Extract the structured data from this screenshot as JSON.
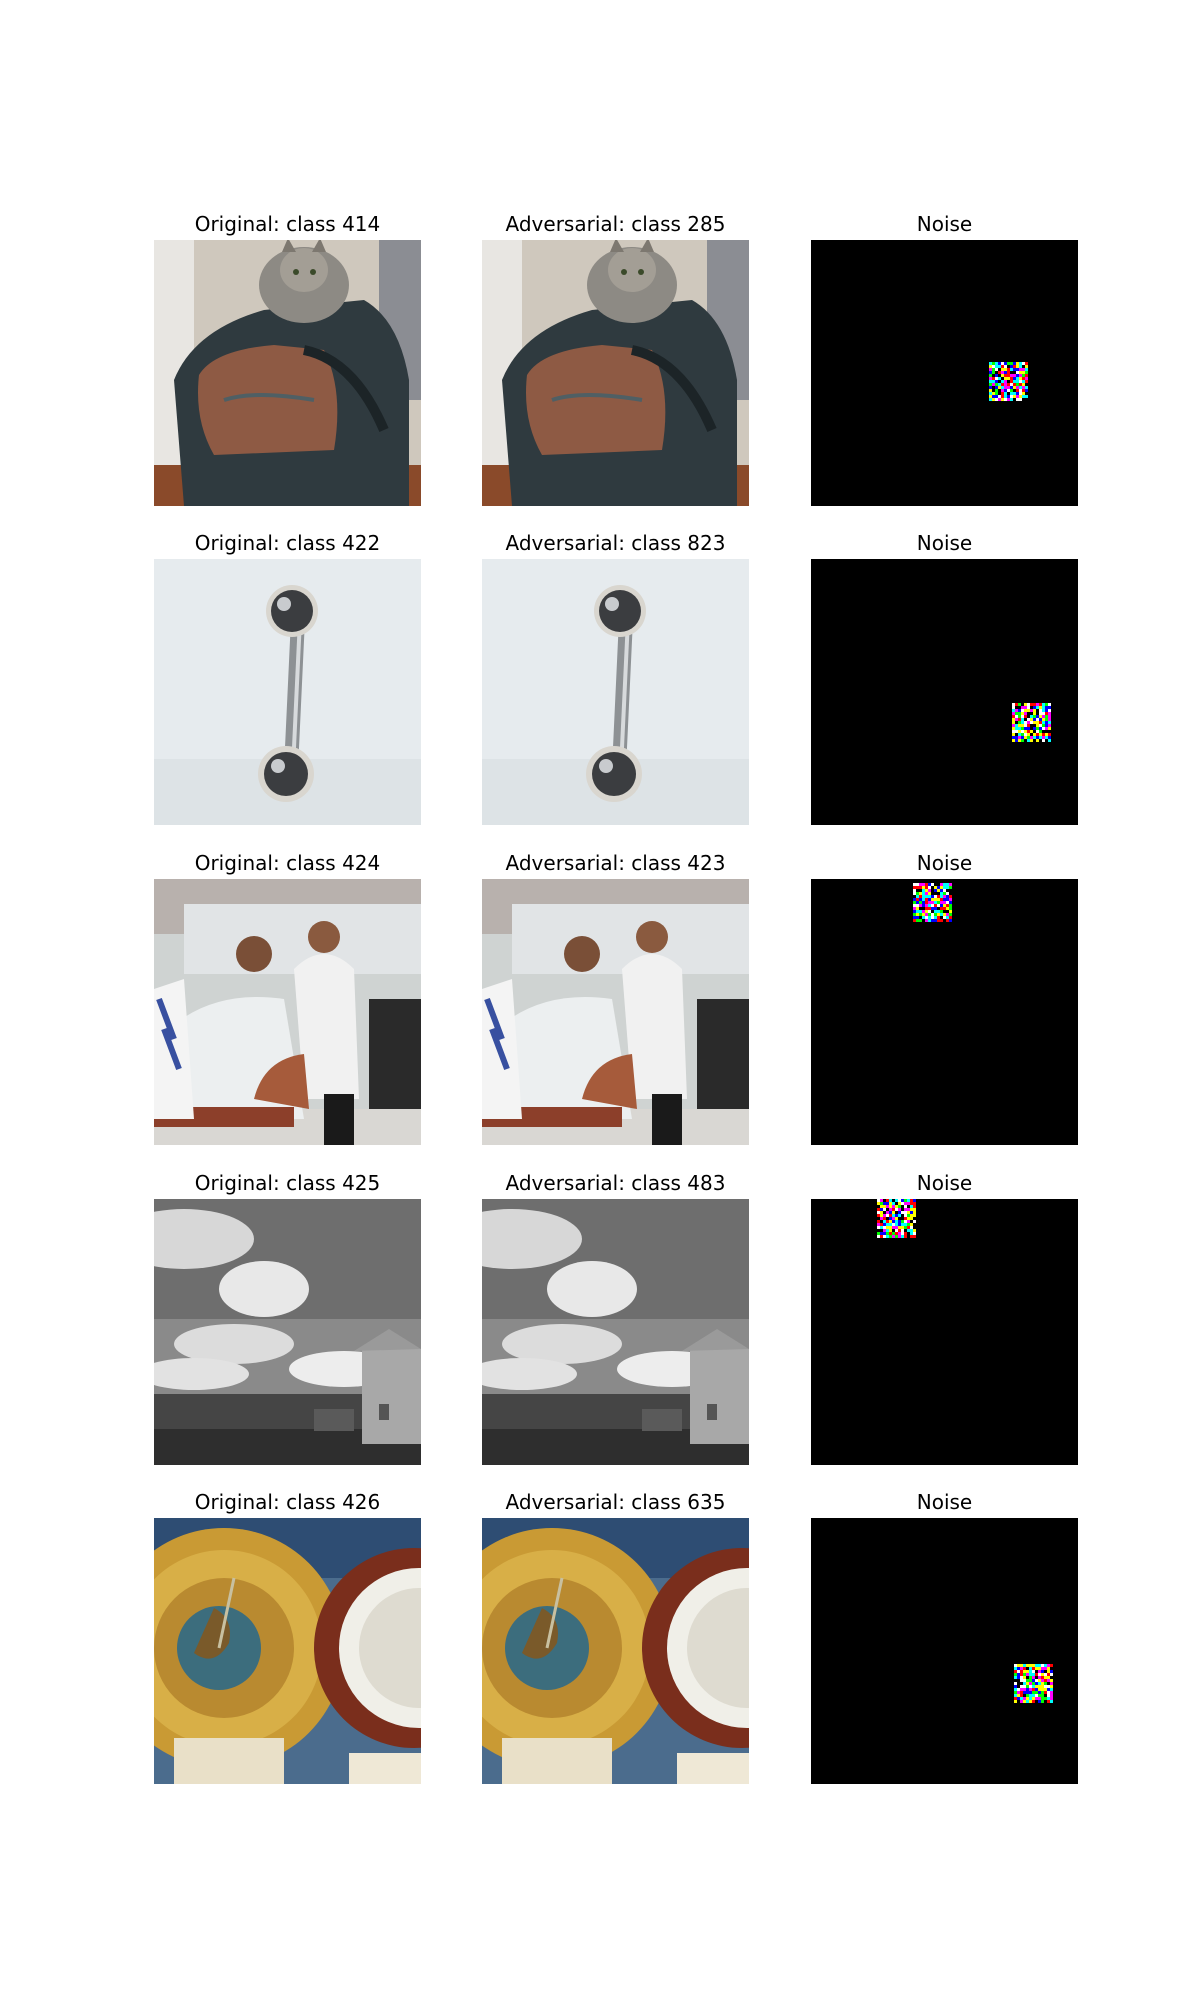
{
  "figure": {
    "rows": [
      {
        "original": {
          "title": "Original: class 414",
          "image": "cat-in-backpack-photo"
        },
        "adversarial": {
          "title": "Adversarial: class 285",
          "image": "cat-in-backpack-photo"
        },
        "noise": {
          "title": "Noise",
          "image": "noise-patch-black"
        }
      },
      {
        "original": {
          "title": "Original: class 422",
          "image": "barbell-piercing-photo"
        },
        "adversarial": {
          "title": "Adversarial: class 823",
          "image": "barbell-piercing-photo"
        },
        "noise": {
          "title": "Noise",
          "image": "noise-patch-black"
        }
      },
      {
        "original": {
          "title": "Original: class 424",
          "image": "barbershop-photo"
        },
        "adversarial": {
          "title": "Adversarial: class 423",
          "image": "barbershop-photo"
        },
        "noise": {
          "title": "Noise",
          "image": "noise-patch-black"
        }
      },
      {
        "original": {
          "title": "Original: class 425",
          "image": "grayscale-landscape-photo"
        },
        "adversarial": {
          "title": "Adversarial: class 483",
          "image": "grayscale-landscape-photo"
        },
        "noise": {
          "title": "Noise",
          "image": "noise-patch-black"
        }
      },
      {
        "original": {
          "title": "Original: class 426",
          "image": "barometer-photo"
        },
        "adversarial": {
          "title": "Adversarial: class 635",
          "image": "barometer-photo"
        },
        "noise": {
          "title": "Noise",
          "image": "noise-patch-black"
        }
      }
    ],
    "noise_colors": [
      "#ff0000",
      "#00ff00",
      "#0000ff",
      "#ffff00",
      "#ff00ff",
      "#00ffff",
      "#ffffff",
      "#000000"
    ]
  }
}
